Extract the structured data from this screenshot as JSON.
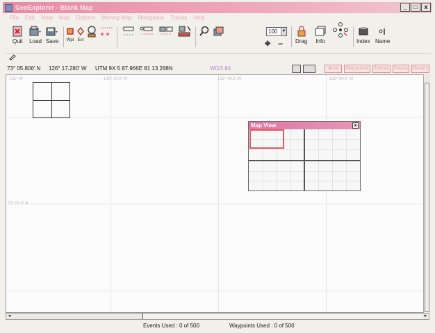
{
  "window": {
    "title": "GeoExplorer - Blank Map",
    "controls": [
      "_",
      "□",
      "x"
    ]
  },
  "menu": [
    "File",
    "Edit",
    "View",
    "Map",
    "Options",
    "Moving Map",
    "Navigation",
    "Tracks",
    "Help"
  ],
  "toolbar": {
    "quit": "Quit",
    "load": "Load",
    "save": "Save",
    "wpt": "Wpt",
    "evt": "Evt",
    "zoom_value": "100",
    "drag": "Drag",
    "info": "Info",
    "index": "Index",
    "name": "Name"
  },
  "status": {
    "lat": "73° 05.806' N",
    "lon": "126° 17.280' W",
    "utm": "UTM 9X  5 87 966E  81 13 268N",
    "datum": "WGS 84",
    "tabs": [
      "Area",
      "Waypoints",
      "Events",
      "Tracks",
      "Routes"
    ]
  },
  "map": {
    "coord_labels": [
      "135° W",
      "130° 00.0' W",
      "125° 00.0' W",
      "120° 00.0' W",
      "70° 00.0' N"
    ]
  },
  "map_view": {
    "title": "Map View",
    "close": "x"
  },
  "footer": {
    "events": "Events Used : 0 of 500",
    "waypoints": "Waypoints Used : 0 of 500"
  },
  "colors": {
    "title_bar": "#e98aa6",
    "map_view_title": "#de76a5",
    "selection": "#e05a5a"
  }
}
